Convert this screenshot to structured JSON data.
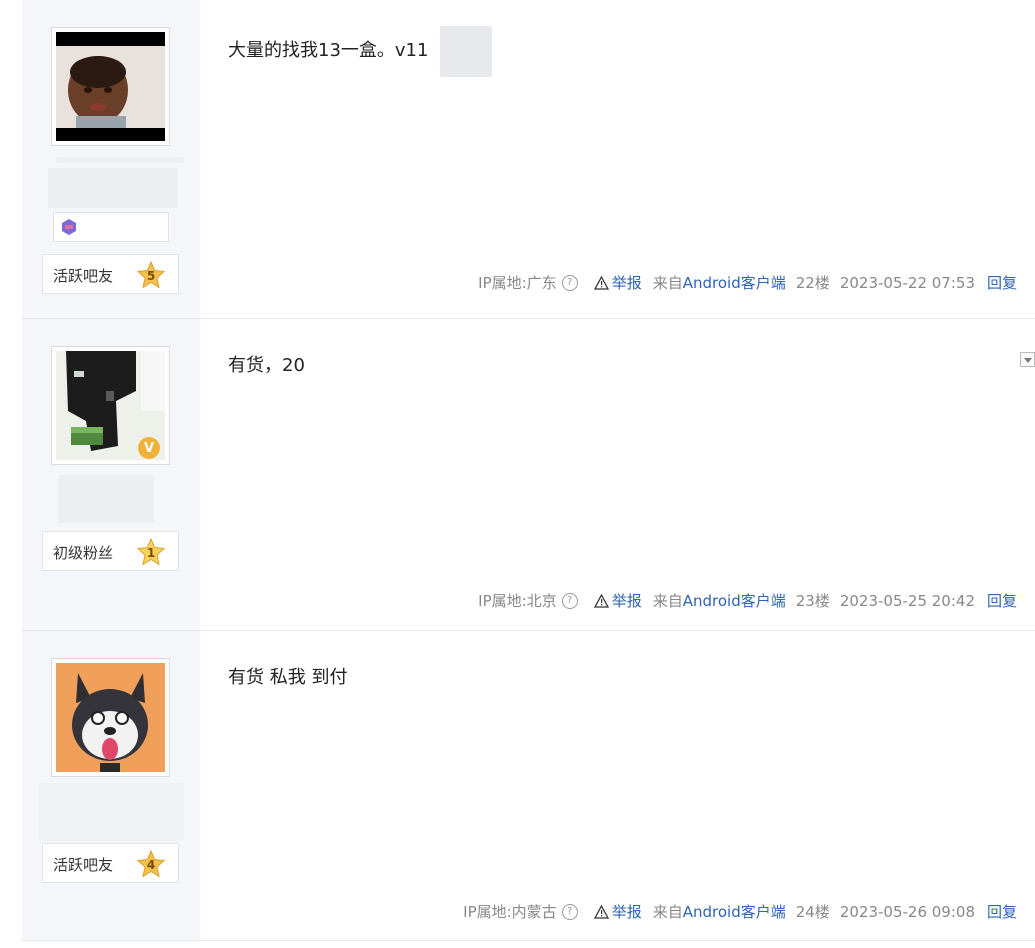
{
  "posts": [
    {
      "content": "大量的找我13一盒。v11",
      "title_badge": "活跃吧友",
      "level": "5",
      "meta": {
        "ip": "IP属地:广东",
        "help_glyph": "?",
        "report": "举报",
        "source_prefix": "来自",
        "source_link": "Android客户端",
        "floor": "22楼",
        "time": "2023-05-22 07:53",
        "reply": "回复"
      }
    },
    {
      "content": "有货，20",
      "title_badge": "初级粉丝",
      "level": "1",
      "vip_mark": "V",
      "meta": {
        "ip": "IP属地:北京",
        "help_glyph": "?",
        "report": "举报",
        "source_prefix": "来自",
        "source_link": "Android客户端",
        "floor": "23楼",
        "time": "2023-05-25 20:42",
        "reply": "回复"
      }
    },
    {
      "content": "有货 私我 到付",
      "title_badge": "活跃吧友",
      "level": "4",
      "meta": {
        "ip": "IP属地:内蒙古",
        "help_glyph": "?",
        "report": "举报",
        "source_prefix": "来自",
        "source_link": "Android客户端",
        "floor": "24楼",
        "time": "2023-05-26 09:08",
        "reply": "回复"
      }
    }
  ],
  "colors": {
    "link_blue": "#2d64b3",
    "meta_gray": "#888888",
    "sidebar_bg": "#f5f6f9",
    "star_gold": "#f2c14e"
  }
}
